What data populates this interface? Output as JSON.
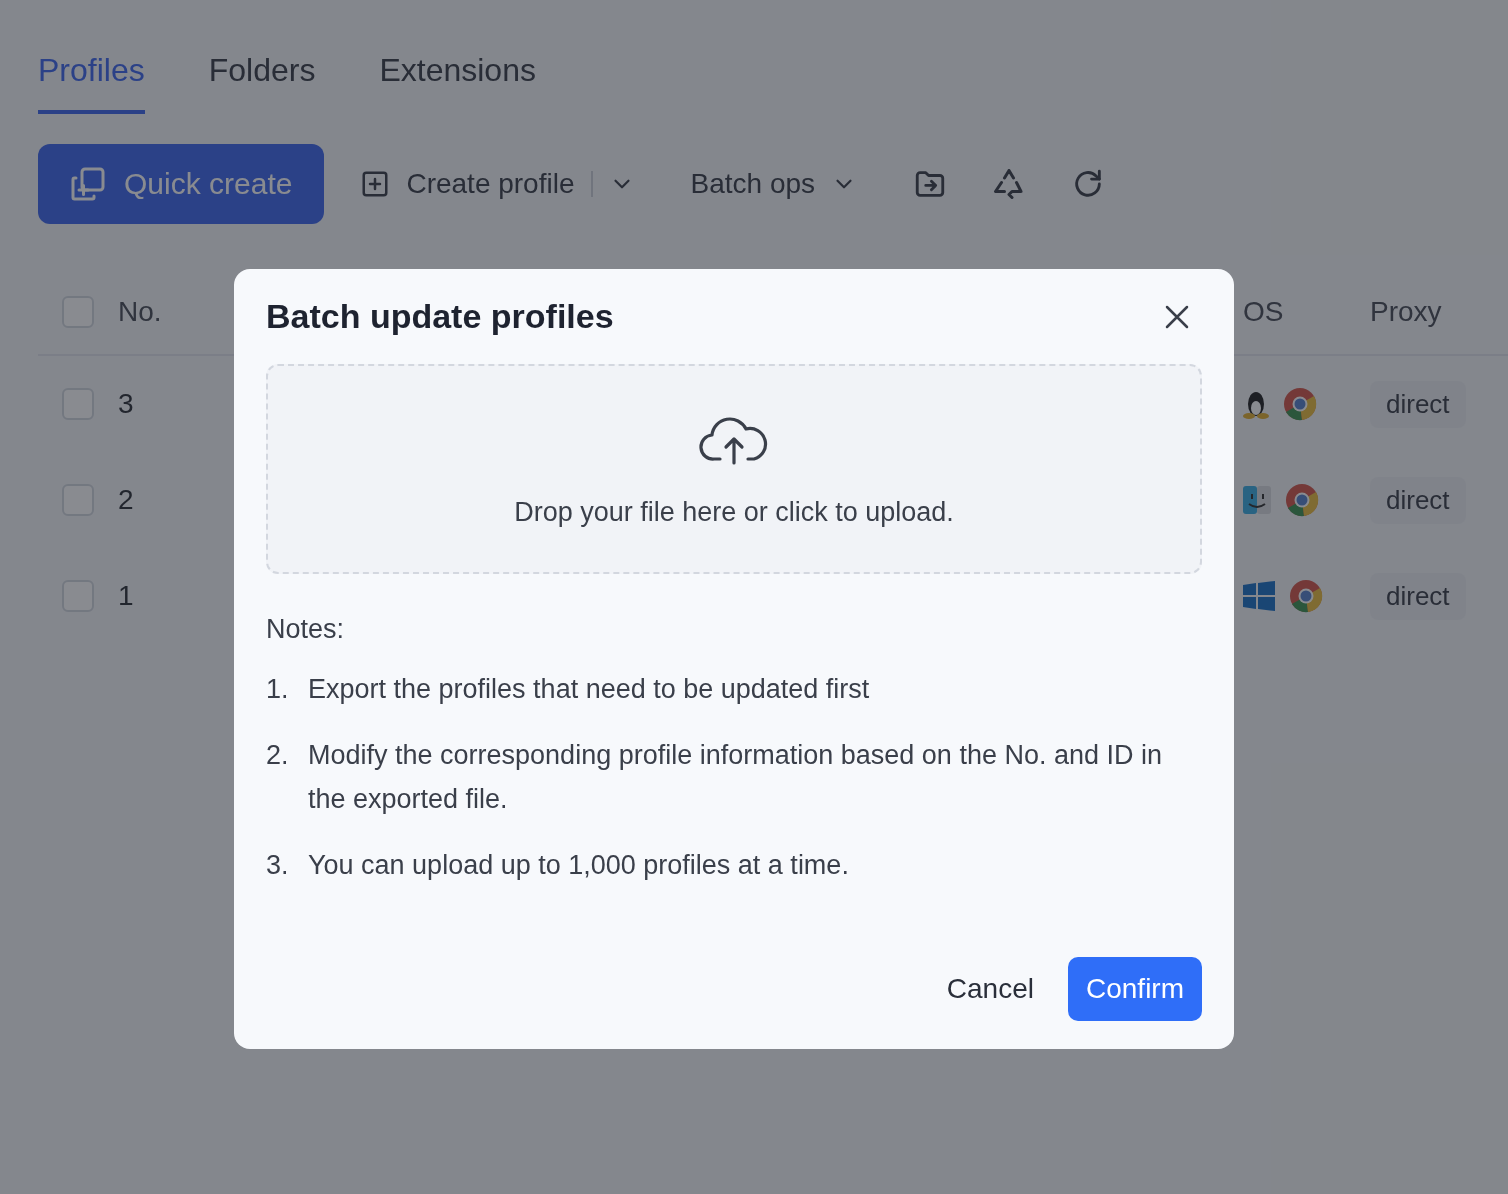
{
  "tabs": [
    {
      "label": "Profiles",
      "selected": true
    },
    {
      "label": "Folders",
      "selected": false
    },
    {
      "label": "Extensions",
      "selected": false
    }
  ],
  "toolbar": {
    "quick_create": "Quick create",
    "create_profile": "Create profile",
    "batch_ops": "Batch ops"
  },
  "table": {
    "columns": [
      "No.",
      "OS",
      "Proxy"
    ],
    "rows": [
      {
        "no": "3",
        "checked": false,
        "kind": "linux",
        "proxy": "direct"
      },
      {
        "no": "2",
        "checked": false,
        "kind": "mac",
        "proxy": "direct"
      },
      {
        "no": "1",
        "checked": false,
        "kind": "windows",
        "proxy": "direct"
      }
    ]
  },
  "header_checked": false,
  "dialog": {
    "title": "Batch update profiles",
    "upload_text": "Drop your file here or click to upload.",
    "notes_title": "Notes:",
    "notes": [
      {
        "number": "1.",
        "text": "Export the profiles that need to be updated first"
      },
      {
        "number": "2.",
        "text": "Modify the corresponding profile information based on the No. and ID in the exported file."
      },
      {
        "number": "3.",
        "text": "You can upload up to 1,000 profiles at a time."
      }
    ],
    "buttons": {
      "cancel": "Cancel",
      "confirm": "Confirm"
    }
  }
}
